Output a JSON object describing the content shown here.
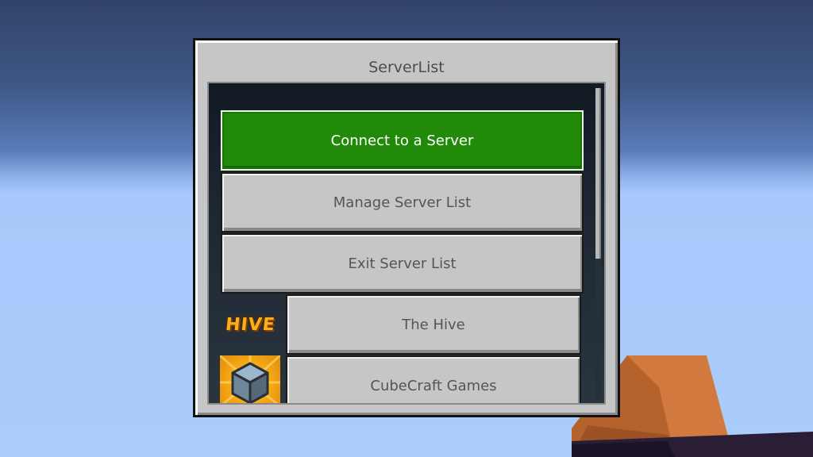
{
  "dialog": {
    "title": "ServerList"
  },
  "buttons": {
    "connect": "Connect to a Server",
    "manage": "Manage Server List",
    "exit": "Exit Server List"
  },
  "servers": [
    {
      "name": "The Hive",
      "logo_text": "HIVE",
      "icon": "hive-logo"
    },
    {
      "name": "CubeCraft Games",
      "icon": "cubecraft-cube-icon"
    }
  ],
  "colors": {
    "primary_button": "#218b09",
    "panel": "#c6c6c6",
    "list_background": "#1d2732",
    "sky": "#aacdfd"
  }
}
